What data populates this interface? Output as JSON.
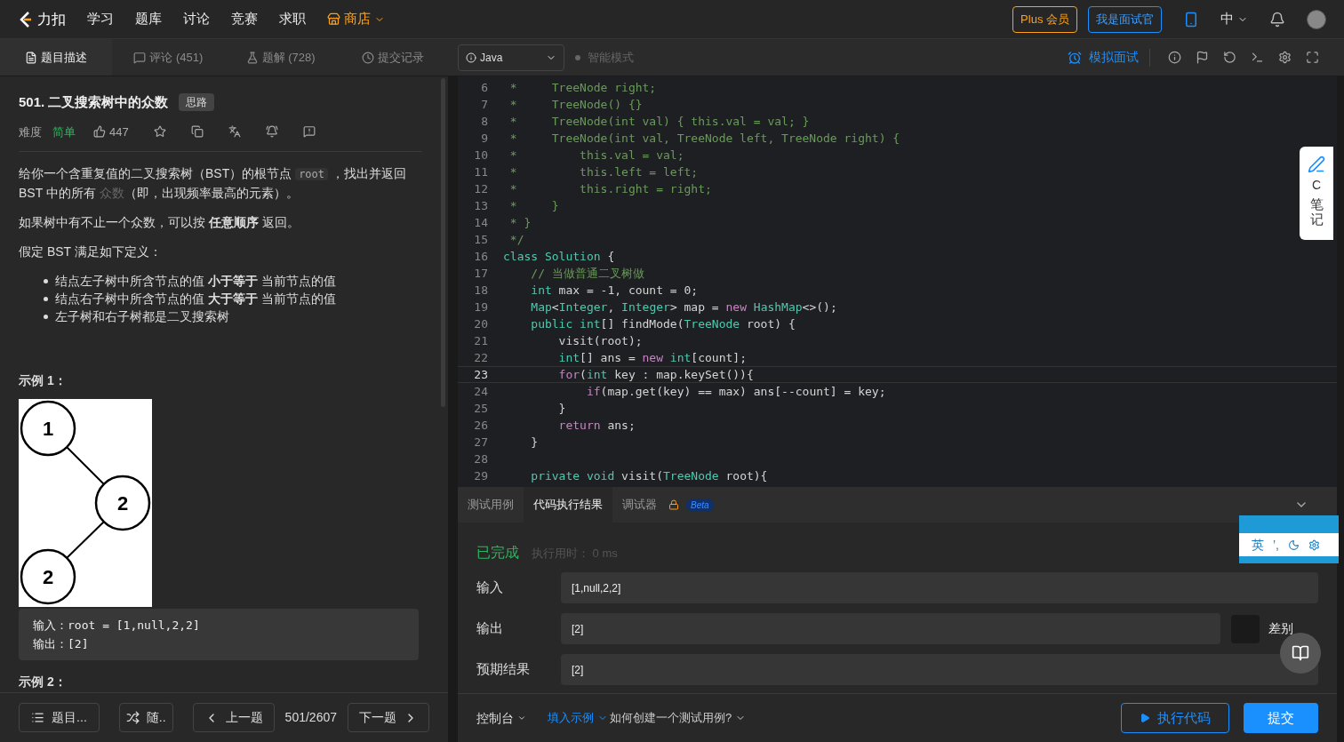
{
  "nav": {
    "brand": "力扣",
    "items": [
      {
        "label": "学习",
        "kind": "plain"
      },
      {
        "label": "题库",
        "kind": "plain"
      },
      {
        "label": "讨论",
        "kind": "plain"
      },
      {
        "label": "竞赛",
        "kind": "plain"
      },
      {
        "label": "求职",
        "kind": "plain"
      },
      {
        "label": "商店",
        "kind": "store"
      }
    ],
    "plus": "Plus 会员",
    "interviewer": "我是面试官",
    "language": "中"
  },
  "tabs": [
    {
      "label": "题目描述",
      "selected": true,
      "kind": "desc"
    },
    {
      "label": "评论 (451)",
      "selected": false,
      "kind": "comment"
    },
    {
      "label": "题解 (728)",
      "selected": false,
      "kind": "solution"
    },
    {
      "label": "提交记录",
      "selected": false,
      "kind": "history"
    }
  ],
  "editor_bar": {
    "language": "Java",
    "smart_mode": {
      "label": "智能模式",
      "on": false
    },
    "mock": "模拟面试"
  },
  "problem": {
    "title": "501. 二叉搜索树中的众数",
    "tag": "思路",
    "difficulty_label": "难度",
    "difficulty": "简单",
    "likes": "447",
    "paragraphs": [
      [
        {
          "text": "给你一个含重复值的二叉搜索树（BST）的根节点 ",
          "kind": "plain"
        },
        {
          "text": "root",
          "kind": "code"
        },
        {
          "text": " ，找出并返回 BST 中的所有 ",
          "kind": "plain"
        },
        {
          "text": "众数",
          "kind": "term"
        },
        {
          "text": "（即，出现频率最高的元素）。",
          "kind": "plain"
        }
      ],
      [
        {
          "text": "如果树中有不止一个众数，可以按 **任意顺序** 返回。",
          "kind": "plain"
        }
      ],
      [
        {
          "text": "假定 BST 满足如下定义：",
          "kind": "plain"
        }
      ]
    ],
    "bullets": [
      "结点左子树中所含节点的值 **小于等于** 当前节点的值",
      "结点右子树中所含节点的值 **大于等于** 当前节点的值",
      "左子树和右子树都是二叉搜索树"
    ],
    "example_1": {
      "heading": "示例 1：",
      "tree_nodes": [
        "1",
        "2",
        "2"
      ],
      "lines": [
        "输入：root = [1,null,2,2]",
        "输出：[2]"
      ]
    },
    "example_2": {
      "heading": "示例 2："
    }
  },
  "footer": {
    "list": "题目...",
    "random": "随..",
    "prev": "上一题",
    "position": "501/2607",
    "next": "下一题"
  },
  "code": [
    {
      "number": "6",
      "selected": false,
      "tokens": [
        {
          "text": " *     TreeNode right;",
          "kind": "comment"
        }
      ]
    },
    {
      "number": "7",
      "selected": false,
      "tokens": [
        {
          "text": " *     TreeNode() {}",
          "kind": "comment"
        }
      ]
    },
    {
      "number": "8",
      "selected": false,
      "tokens": [
        {
          "text": " *     TreeNode(int val) { this.val = val; }",
          "kind": "comment"
        }
      ]
    },
    {
      "number": "9",
      "selected": false,
      "tokens": [
        {
          "text": " *     TreeNode(int val, TreeNode left, TreeNode right) {",
          "kind": "comment"
        }
      ]
    },
    {
      "number": "10",
      "selected": false,
      "tokens": [
        {
          "text": " *         this.val = val;",
          "kind": "comment"
        }
      ]
    },
    {
      "number": "11",
      "selected": false,
      "tokens": [
        {
          "text": " *         this.left = left;",
          "kind": "comment"
        }
      ]
    },
    {
      "number": "12",
      "selected": false,
      "tokens": [
        {
          "text": " *         this.right = right;",
          "kind": "comment"
        }
      ]
    },
    {
      "number": "13",
      "selected": false,
      "tokens": [
        {
          "text": " *     }",
          "kind": "comment"
        }
      ]
    },
    {
      "number": "14",
      "selected": false,
      "tokens": [
        {
          "text": " * }",
          "kind": "comment"
        }
      ]
    },
    {
      "number": "15",
      "selected": false,
      "tokens": [
        {
          "text": " */",
          "kind": "comment"
        }
      ]
    },
    {
      "number": "16",
      "selected": false,
      "tokens": [
        {
          "text": "class ",
          "kind": "keyword"
        },
        {
          "text": "Solution",
          "kind": "keyword"
        },
        {
          "text": " {",
          "kind": "plain"
        }
      ]
    },
    {
      "number": "17",
      "selected": false,
      "tokens": [
        {
          "text": "    // 当做普通二叉树做",
          "kind": "comment"
        }
      ]
    },
    {
      "number": "18",
      "selected": false,
      "tokens": [
        {
          "text": "    int",
          "kind": "keyword"
        },
        {
          "text": " max = -1, count = 0;",
          "kind": "plain"
        }
      ]
    },
    {
      "number": "19",
      "selected": false,
      "tokens": [
        {
          "text": "    Map",
          "kind": "keyword"
        },
        {
          "text": "<",
          "kind": "plain"
        },
        {
          "text": "Integer",
          "kind": "keyword"
        },
        {
          "text": ", ",
          "kind": "plain"
        },
        {
          "text": "Integer",
          "kind": "keyword"
        },
        {
          "text": "> map = ",
          "kind": "plain"
        },
        {
          "text": "new ",
          "kind": "control"
        },
        {
          "text": "HashMap",
          "kind": "keyword"
        },
        {
          "text": "<>();",
          "kind": "plain"
        }
      ]
    },
    {
      "number": "20",
      "selected": false,
      "tokens": [
        {
          "text": "    public int",
          "kind": "keyword"
        },
        {
          "text": "[] findMode(",
          "kind": "plain"
        },
        {
          "text": "TreeNode",
          "kind": "keyword"
        },
        {
          "text": " root) {",
          "kind": "plain"
        }
      ]
    },
    {
      "number": "21",
      "selected": false,
      "tokens": [
        {
          "text": "        visit(root);",
          "kind": "plain"
        }
      ]
    },
    {
      "number": "22",
      "selected": false,
      "tokens": [
        {
          "text": "        int",
          "kind": "keyword"
        },
        {
          "text": "[] ans = ",
          "kind": "plain"
        },
        {
          "text": "new ",
          "kind": "control"
        },
        {
          "text": "int",
          "kind": "keyword"
        },
        {
          "text": "[count];",
          "kind": "plain"
        }
      ]
    },
    {
      "number": "23",
      "selected": true,
      "tokens": [
        {
          "text": "        for",
          "kind": "control"
        },
        {
          "text": "(",
          "kind": "plain"
        },
        {
          "text": "int",
          "kind": "keyword"
        },
        {
          "text": " key : map.keySet()){",
          "kind": "plain"
        }
      ]
    },
    {
      "number": "24",
      "selected": false,
      "tokens": [
        {
          "text": "            if",
          "kind": "control"
        },
        {
          "text": "(map.get(key) == max) ans[--count] = key;",
          "kind": "plain"
        }
      ]
    },
    {
      "number": "25",
      "selected": false,
      "tokens": [
        {
          "text": "        }",
          "kind": "plain"
        }
      ]
    },
    {
      "number": "26",
      "selected": false,
      "tokens": [
        {
          "text": "        return",
          "kind": "control"
        },
        {
          "text": " ans;",
          "kind": "plain"
        }
      ]
    },
    {
      "number": "27",
      "selected": false,
      "tokens": [
        {
          "text": "    }",
          "kind": "plain"
        }
      ]
    },
    {
      "number": "28",
      "selected": false
    },
    {
      "number": "29",
      "selected": false,
      "tokens": [
        {
          "text": "    private void ",
          "kind": "keyword"
        },
        {
          "text": "visit(",
          "kind": "plain"
        },
        {
          "text": "TreeNode",
          "kind": "keyword"
        },
        {
          "text": " root){",
          "kind": "plain"
        }
      ]
    }
  ],
  "result_tabs": [
    {
      "label": "测试用例",
      "selected": false,
      "locked": false
    },
    {
      "label": "代码执行结果",
      "selected": true,
      "locked": false
    },
    {
      "label": "调试器",
      "selected": false,
      "locked": true,
      "badge": "Beta"
    }
  ],
  "result": {
    "status": "已完成",
    "runtime": "执行用时： 0 ms",
    "rows": [
      {
        "label": "输入",
        "value": "[1,null,2,2]",
        "kind": "plain"
      },
      {
        "label": "输出",
        "value": "[2]",
        "kind": "diff",
        "diff_label": "差别"
      },
      {
        "label": "预期结果",
        "value": "[2]",
        "kind": "plain"
      }
    ]
  },
  "console": {
    "label": "控制台",
    "fill": "填入示例",
    "help": "如何创建一个测试用例?",
    "run": "执行代码",
    "submit": "提交"
  },
  "side_widget": {
    "letter": "C",
    "label": "笔记"
  },
  "ime": {
    "mode": "英",
    "punctuation": "’,"
  }
}
